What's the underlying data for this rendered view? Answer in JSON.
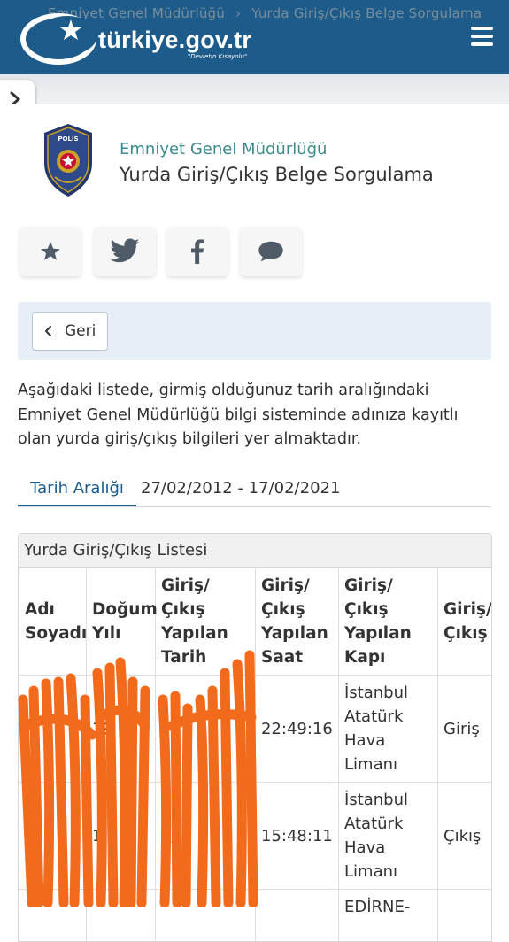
{
  "header": {
    "breadcrumb": [
      "Emniyet Genel Müdürlüğü",
      "Yurda Giriş/Çıkış Belge Sorgulama"
    ],
    "brand": "türkiye.gov.tr",
    "motto": "\"Devletin Kısayolu\""
  },
  "service": {
    "agency": "Emniyet Genel Müdürlüğü",
    "title": "Yurda Giriş/Çıkış Belge Sorgulama"
  },
  "share": {
    "icons": [
      "star-icon",
      "twitter-icon",
      "facebook-icon",
      "comment-icon"
    ]
  },
  "toolbar": {
    "back_label": "Geri"
  },
  "description": "Aşağıdaki listede, girmiş olduğunuz tarih aralığındaki Emniyet Genel Müdürlüğü bilgi sisteminde adınıza kayıtlı olan yurda giriş/çıkış bilgileri yer almaktadır.",
  "filter": {
    "tab_label": "Tarih Aralığı",
    "range": "27/02/2012 - 17/02/2021"
  },
  "list": {
    "title": "Yurda Giriş/Çıkış Listesi",
    "columns": [
      "Adı Soyadı",
      "Doğum Yılı",
      "Giriş/Çıkış Yapılan Tarih",
      "Giriş/ Çıkış Yapılan Saat",
      "Giriş/Çıkış Yapılan Kapı",
      "Giriş/ Çıkış"
    ],
    "rows": [
      {
        "name": "",
        "birth_year": "19",
        "date": "",
        "time": "22:49:16",
        "gate": "İstanbul Atatürk Hava Limanı",
        "direction": "Giriş"
      },
      {
        "name": "",
        "birth_year": "1",
        "date": "9/",
        "time": "15:48:11",
        "gate": "İstanbul Atatürk Hava Limanı",
        "direction": "Çıkış"
      },
      {
        "name": "",
        "birth_year": "",
        "date": "",
        "time": "",
        "gate": "EDİRNE-",
        "direction": ""
      }
    ]
  },
  "colors": {
    "header_blue": "#1d5b8b",
    "agency_teal": "#3d8a8c",
    "redaction_orange": "#f26b1d"
  }
}
